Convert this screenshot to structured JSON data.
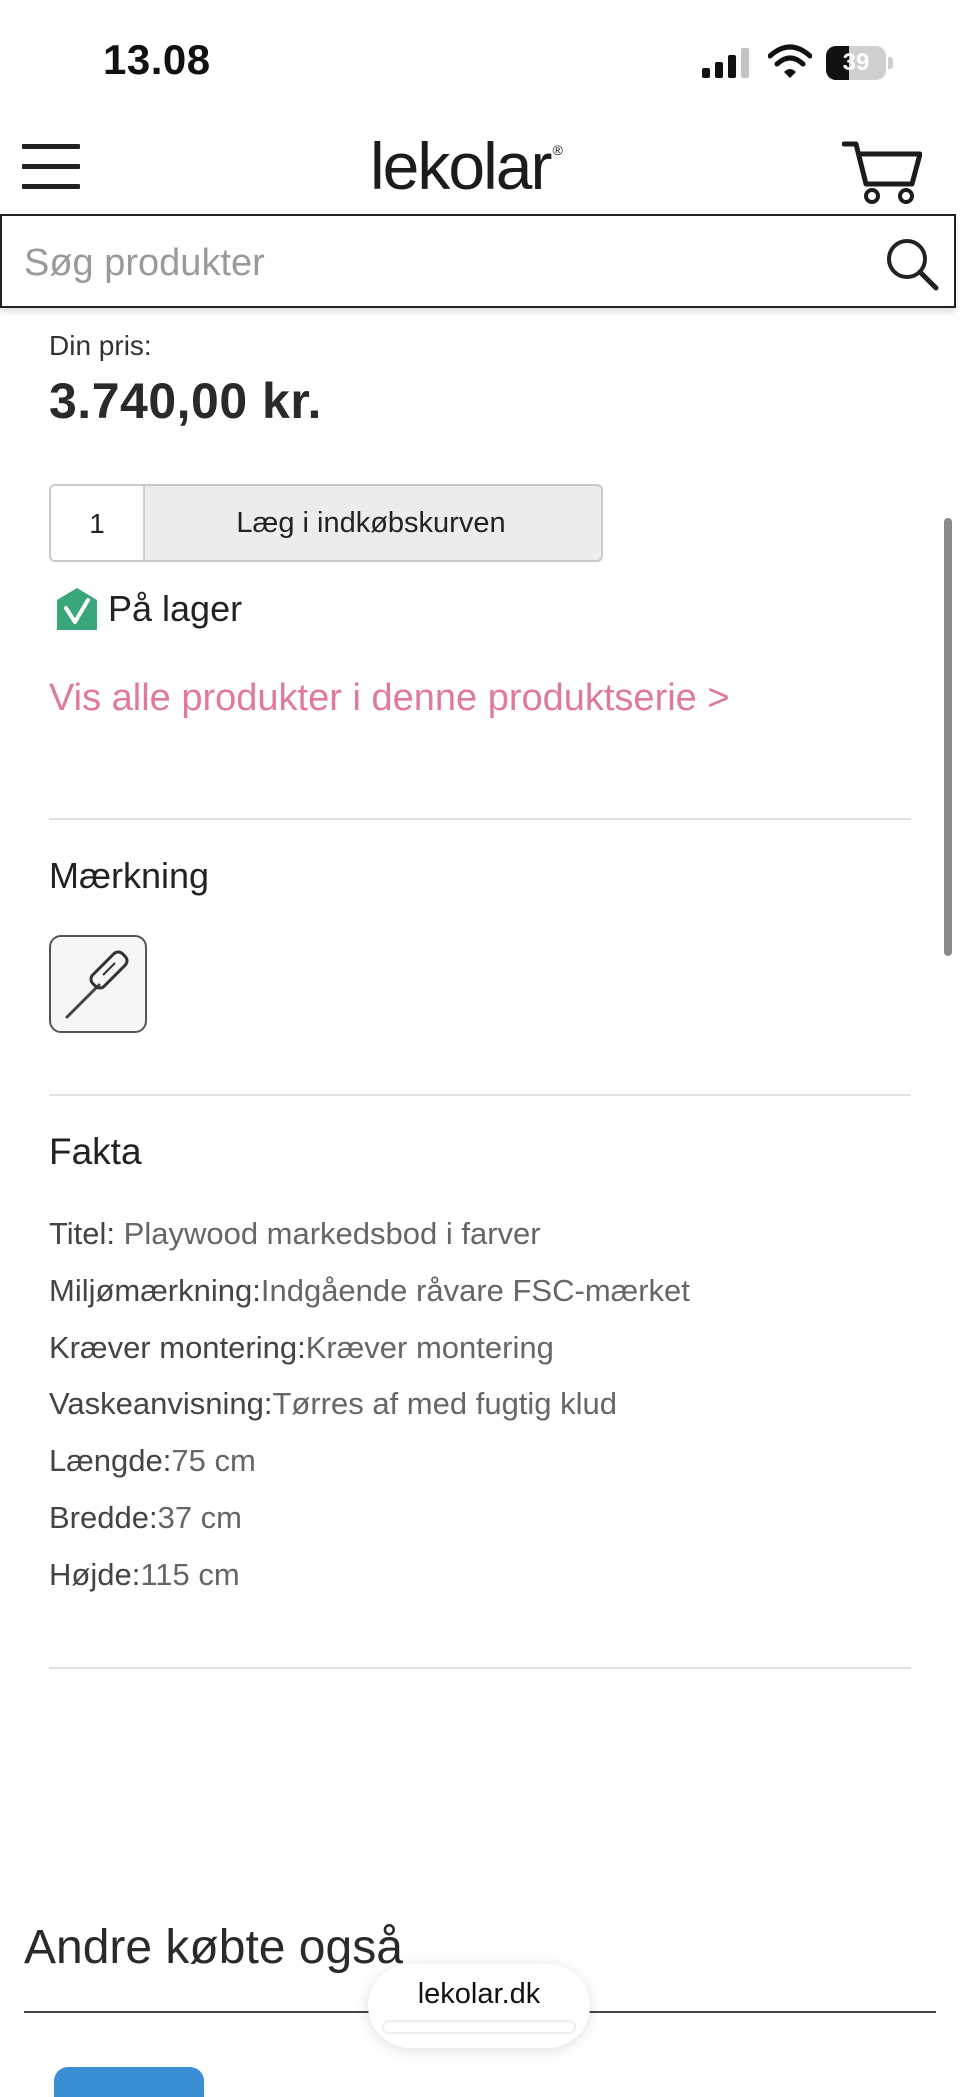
{
  "status_bar": {
    "time": "13.08",
    "battery": "39",
    "battery_fraction": 0.39
  },
  "header": {
    "logo_text": "lekolar",
    "logo_mark": "®"
  },
  "search": {
    "placeholder": "Søg produkter"
  },
  "product": {
    "price_label": "Din pris:",
    "price": "3.740,00 kr.",
    "quantity": "1",
    "add_to_cart_label": "Læg i indkøbskurven",
    "stock_status": "På lager",
    "series_link": "Vis alle produkter i denne produktserie >"
  },
  "marking": {
    "title": "Mærkning",
    "icon": "screwdriver-icon"
  },
  "facts": {
    "title": "Fakta",
    "items": [
      {
        "label": "Titel:",
        "value": " Playwood markedsbod i farver"
      },
      {
        "label": "Miljømærkning:",
        "value": "Indgående råvare FSC-mærket"
      },
      {
        "label": "Kræver montering:",
        "value": "Kræver montering"
      },
      {
        "label": "Vaskeanvisning:",
        "value": "Tørres af med fugtig klud"
      },
      {
        "label": "Længde:",
        "value": "75 cm"
      },
      {
        "label": "Bredde:",
        "value": "37 cm"
      },
      {
        "label": "Højde:",
        "value": "115 cm"
      }
    ]
  },
  "also_bought": {
    "title": "Andre købte også"
  },
  "browser": {
    "url": "lekolar.dk"
  },
  "colors": {
    "link": "#e07a9d",
    "stock_green": "#3aa77a",
    "accent_blue": "#3a8fd4"
  }
}
